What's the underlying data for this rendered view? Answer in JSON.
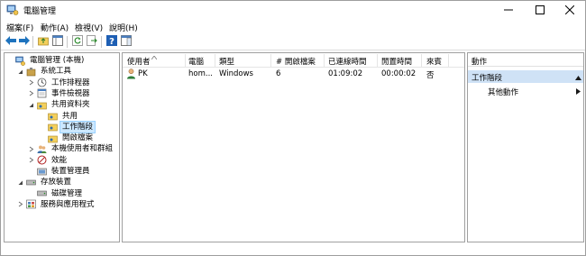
{
  "window": {
    "title": "電腦管理",
    "minimize_icon": "minimize-icon",
    "maximize_icon": "maximize-icon",
    "close_icon": "close-icon"
  },
  "menu": [
    {
      "label": "檔案(F)"
    },
    {
      "label": "動作(A)"
    },
    {
      "label": "檢視(V)"
    },
    {
      "label": "說明(H)"
    }
  ],
  "toolbar": {
    "icons": [
      "back-arrow-icon",
      "forward-arrow-icon",
      "up-folder-icon",
      "show-hide-tree-icon",
      "refresh-icon",
      "export-list-icon",
      "help-icon",
      "properties-icon"
    ]
  },
  "tree": {
    "items": [
      {
        "label": "電腦管理 (本機)",
        "icon": "computer-management-icon",
        "level": 0,
        "expander": "none"
      },
      {
        "label": "系統工具",
        "icon": "system-tools-icon",
        "level": 1,
        "expander": "expanded"
      },
      {
        "label": "工作排程器",
        "icon": "task-scheduler-icon",
        "level": 2,
        "expander": "collapsed"
      },
      {
        "label": "事件檢視器",
        "icon": "event-viewer-icon",
        "level": 2,
        "expander": "collapsed"
      },
      {
        "label": "共用資料夾",
        "icon": "shared-folder-icon",
        "level": 2,
        "expander": "expanded"
      },
      {
        "label": "共用",
        "icon": "shares-icon",
        "level": 3,
        "expander": "none"
      },
      {
        "label": "工作階段",
        "icon": "sessions-icon",
        "level": 3,
        "expander": "none",
        "selected": true
      },
      {
        "label": "開啟檔案",
        "icon": "open-files-icon",
        "level": 3,
        "expander": "none"
      },
      {
        "label": "本機使用者和群組",
        "icon": "users-groups-icon",
        "level": 2,
        "expander": "collapsed"
      },
      {
        "label": "效能",
        "icon": "performance-icon",
        "level": 2,
        "expander": "collapsed"
      },
      {
        "label": "裝置管理員",
        "icon": "device-manager-icon",
        "level": 2,
        "expander": "none"
      },
      {
        "label": "存放裝置",
        "icon": "storage-icon",
        "level": 1,
        "expander": "expanded"
      },
      {
        "label": "磁碟管理",
        "icon": "disk-management-icon",
        "level": 2,
        "expander": "none"
      },
      {
        "label": "服務與應用程式",
        "icon": "services-apps-icon",
        "level": 1,
        "expander": "collapsed"
      }
    ]
  },
  "list": {
    "columns": [
      {
        "label": "使用者",
        "sorted": true
      },
      {
        "label": "電腦"
      },
      {
        "label": "類型"
      },
      {
        "label": "# 開啟檔案"
      },
      {
        "label": "已連線時間"
      },
      {
        "label": "閒置時間"
      },
      {
        "label": "來賓"
      }
    ],
    "rows": [
      {
        "user": "PK",
        "computer": "hom...",
        "type": "Windows",
        "open_files": "6",
        "connected": "01:09:02",
        "idle": "00:00:02",
        "guest": "否"
      }
    ]
  },
  "actions": {
    "title": "動作",
    "section": "工作階段",
    "items": [
      {
        "label": "其他動作"
      }
    ]
  },
  "colors": {
    "selection": "#cce8ff",
    "action_section": "#cfe2f6",
    "toolbar_blue": "#1e73be"
  }
}
